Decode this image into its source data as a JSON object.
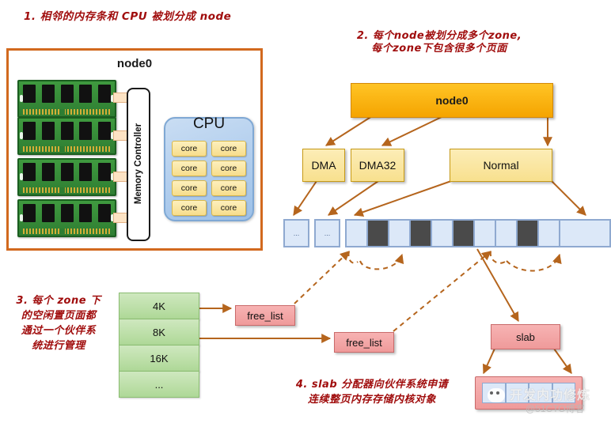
{
  "notes": {
    "n1": "1. 相邻的内存条和 CPU 被划分成 node",
    "n2": "2. 每个node被划分成多个zone,\n每个zone下包含很多个页面",
    "n3": "3. 每个 zone 下\n的空闲置页面都\n通过一个伙伴系\n统进行管理",
    "n4": "4. slab 分配器向伙伴系统申请\n连续整页内存存储内核对象"
  },
  "node_panel": {
    "title": "node0",
    "memory_controller_line1": "Memory",
    "memory_controller_line2": "Controller",
    "cpu_title": "CPU",
    "cores": [
      "core",
      "core",
      "core",
      "core",
      "core",
      "core",
      "core",
      "core"
    ],
    "ram_count": 4
  },
  "zone_tree": {
    "node_label": "node0",
    "zones": [
      {
        "label": "DMA"
      },
      {
        "label": "DMA32"
      },
      {
        "label": "Normal"
      }
    ],
    "page_groups": [
      {
        "cells": [
          "..."
        ]
      },
      {
        "cells": [
          "..."
        ]
      },
      {
        "cells": [
          "",
          "",
          "",
          "",
          "",
          "",
          "",
          "",
          "",
          "",
          "",
          ""
        ],
        "used": [
          1,
          3,
          6,
          9
        ]
      }
    ]
  },
  "buddy": {
    "orders": [
      "4K",
      "8K",
      "16K",
      "..."
    ],
    "free_list_1": "free_list",
    "free_list_2": "free_list"
  },
  "slab": {
    "label": "slab",
    "page_cells": 4
  },
  "watermark": {
    "text": "开发内功修炼",
    "sub": "@51CTO博客"
  },
  "colors": {
    "note_red": "#a00d0d",
    "node_amber": "#f5a400",
    "zone_yellow": "#f8e08e",
    "page_blue": "#dce8f8",
    "page_used": "#4a4a4a",
    "arrow_brown": "#b5651d",
    "buddy_green": "#aed897",
    "red_box": "#ef9a9a",
    "panel_border": "#d2691e"
  }
}
